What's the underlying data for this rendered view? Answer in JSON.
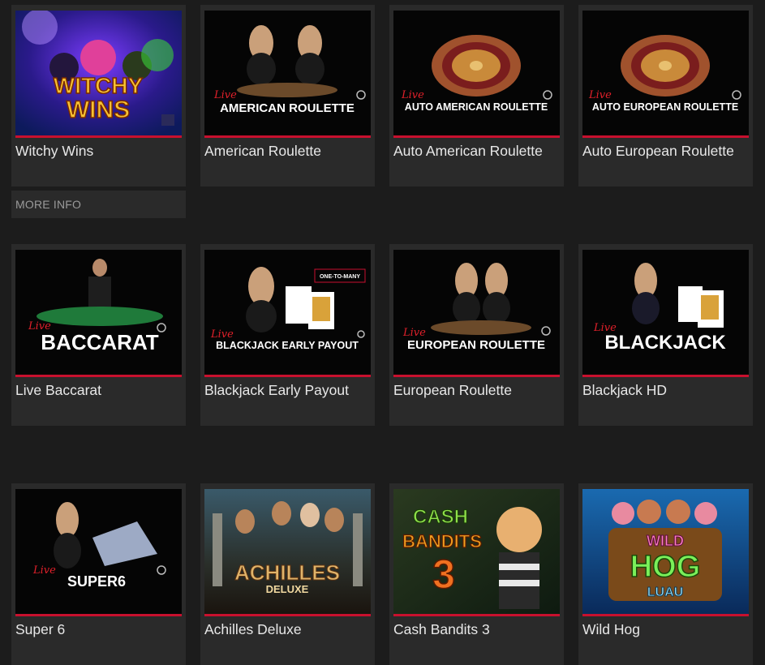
{
  "more_info_label": "MORE INFO",
  "games": [
    {
      "title": "Witchy Wins",
      "art": [
        "WITCHY",
        "WINS"
      ]
    },
    {
      "title": "American Roulette",
      "art": [
        "AMERICAN ROULETTE"
      ],
      "live": "Live"
    },
    {
      "title": "Auto American Roulette",
      "art": [
        "AUTO AMERICAN ROULETTE"
      ],
      "live": "Live"
    },
    {
      "title": "Auto European Roulette",
      "art": [
        "AUTO EUROPEAN ROULETTE"
      ],
      "live": "Live"
    },
    {
      "title": "Live Baccarat",
      "art": [
        "BACCARAT"
      ],
      "live": "Live"
    },
    {
      "title": "Blackjack Early Payout",
      "art": [
        "BLACKJACK EARLY PAYOUT",
        "ONE-TO-MANY"
      ],
      "live": "Live"
    },
    {
      "title": "European Roulette",
      "art": [
        "EUROPEAN ROULETTE"
      ],
      "live": "Live"
    },
    {
      "title": "Blackjack HD",
      "art": [
        "BLACKJACK"
      ],
      "live": "Live"
    },
    {
      "title": "Super 6",
      "art": [
        "SUPER6"
      ],
      "live": "Live"
    },
    {
      "title": "Achilles Deluxe",
      "art": [
        "ACHILLES",
        "DELUXE"
      ]
    },
    {
      "title": "Cash Bandits 3",
      "art": [
        "CASH",
        "BANDITS",
        "3"
      ]
    },
    {
      "title": "Wild Hog",
      "art": [
        "WILD",
        "HOG",
        "LUAU"
      ]
    }
  ],
  "colors": {
    "accent_red": "#c8102e",
    "card_bg": "#2a2a2a",
    "page_bg": "#1c1c1c"
  }
}
